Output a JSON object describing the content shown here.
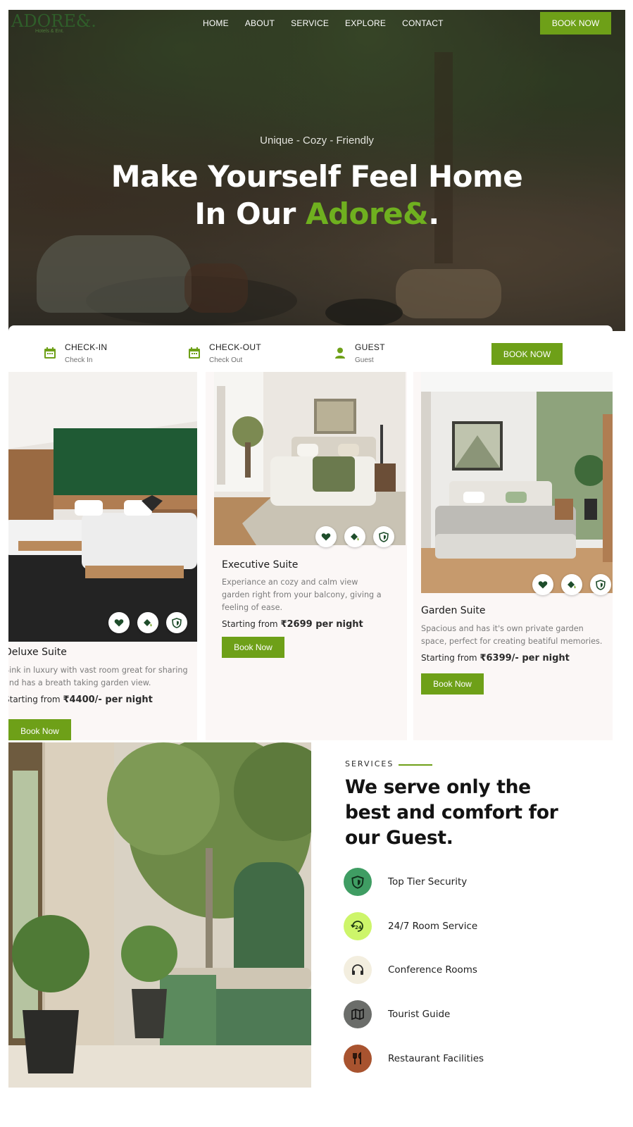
{
  "brand": {
    "name": "ADORE&.",
    "tagline_small": "Hotels & Ent."
  },
  "nav": {
    "items": [
      "HOME",
      "ABOUT",
      "SERVICE",
      "EXPLORE",
      "CONTACT"
    ],
    "book_button": "BOOK NOW"
  },
  "hero": {
    "tagline": "Unique - Cozy - Friendly",
    "headline_line1": "Make Yourself Feel Home",
    "headline_line2_prefix": "In Our ",
    "headline_accent": "Adore&",
    "headline_suffix": "."
  },
  "booking": {
    "checkin": {
      "title": "CHECK-IN",
      "sub": "Check In"
    },
    "checkout": {
      "title": "CHECK-OUT",
      "sub": "Check Out"
    },
    "guest": {
      "title": "GUEST",
      "sub": "Guest"
    },
    "button": "BOOK NOW"
  },
  "rooms": [
    {
      "name": "Deluxe Suite",
      "desc_line1": "Sink in luxury with vast room great for sharing",
      "desc_line2": "and has a breath taking garden view.",
      "price_prefix": "Starting from ",
      "price": "₹4400/- per night",
      "button": "Book Now"
    },
    {
      "name": "Executive Suite",
      "desc_line1": "Experiance an cozy and calm view",
      "desc_line2": "garden right from your balcony, giving a",
      "desc_line3": "feeling of ease.",
      "price_prefix": "Starting from ",
      "price": "₹2699 per night",
      "button": "Book Now"
    },
    {
      "name": "Garden Suite",
      "desc_line1": "Spacious and has it's own private garden",
      "desc_line2": "space, perfect for creating beatiful memories.",
      "price_prefix": "Starting from ",
      "price": "₹6399/- per night",
      "button": "Book Now"
    }
  ],
  "room_icons": [
    "heart-icon",
    "paint-bucket-icon",
    "shield-icon"
  ],
  "services": {
    "label": "SERVICES",
    "heading_line1": "We serve only the",
    "heading_line2": "best and comfort for",
    "heading_line3": "our Guest.",
    "items": [
      {
        "label": "Top Tier Security",
        "icon": "shield-icon",
        "color": "#3f9d63"
      },
      {
        "label": "24/7 Room Service",
        "icon": "24-hour-icon",
        "color": "#cdf56a"
      },
      {
        "label": "Conference Rooms",
        "icon": "headphones-icon",
        "color": "#f3eedf"
      },
      {
        "label": "Tourist Guide",
        "icon": "map-icon",
        "color": "#6b6d6a"
      },
      {
        "label": "Restaurant Facilities",
        "icon": "utensils-icon",
        "color": "#a8532f"
      }
    ]
  },
  "colors": {
    "accent": "#6ea018",
    "logo": "#2f5e2a",
    "card_bg": "#fbf7f6",
    "icon_green": "#1e4d2b"
  }
}
